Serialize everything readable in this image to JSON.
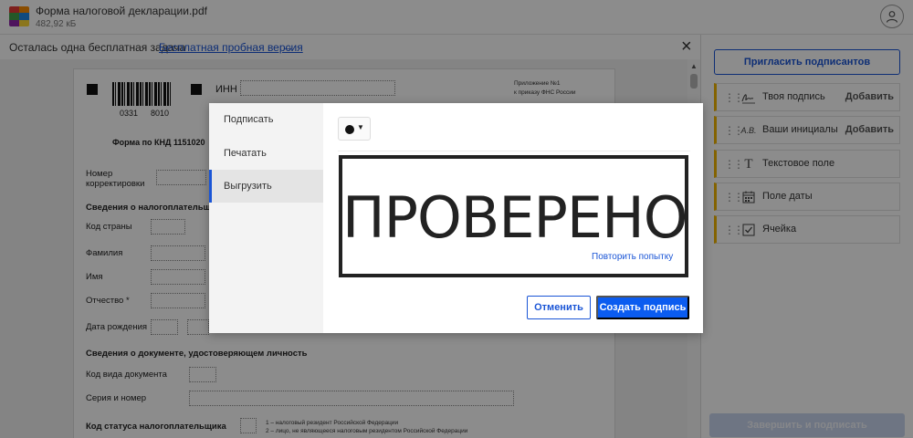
{
  "file": {
    "name": "Форма налоговой декларации.pdf",
    "size": "482,92 кБ"
  },
  "promo": {
    "text": "Осталась одна бесплатная задача",
    "link": "Бесплатная пробная версия"
  },
  "document": {
    "barcode_left": "0331",
    "barcode_right": "8010",
    "inn_label": "ИНН",
    "appendix_line1": "Приложение №1",
    "appendix_line2": "к приказу ФНС России",
    "form_title": "Форма по КНД 1151020",
    "correction_label_1": "Номер",
    "correction_label_2": "корректировки",
    "taxpayer_section": "Сведения о налогоплательщи",
    "country_code": "Код страны",
    "surname": "Фамилия",
    "name": "Имя",
    "patronymic": "Отчество *",
    "birth_date": "Дата рождения",
    "id_section": "Сведения о документе, удостоверяющем личность",
    "doc_type_code": "Код вида документа",
    "series_number": "Серия и номер",
    "status_code": "Код статуса налогоплательщика",
    "status_note_1": "1 – налоговый резидент Российской Федерации",
    "status_note_2": "2 – лицо, не являющееся налоговым резидентом Российской Федерации"
  },
  "sidebar": {
    "invite_button": "Пригласить подписантов",
    "fields": [
      {
        "label": "Твоя подпись",
        "action": "Добавить",
        "icon": "signature-icon"
      },
      {
        "label": "Ваши инициалы",
        "action": "Добавить",
        "icon": "initials-icon"
      },
      {
        "label": "Текстовое поле",
        "action": "",
        "icon": "text-icon"
      },
      {
        "label": "Поле даты",
        "action": "",
        "icon": "calendar-icon"
      },
      {
        "label": "Ячейка",
        "action": "",
        "icon": "checkbox-icon"
      }
    ],
    "initials_glyph": "A.B.",
    "text_glyph": "T",
    "finish_button": "Завершить и подписать"
  },
  "modal": {
    "nav": [
      "Подписать",
      "Печатать",
      "Выгрузить"
    ],
    "active_nav": "Выгрузить",
    "ink_color": "#111111",
    "stamp_text": "ПРОВЕРЕНО",
    "retry_link": "Повторить попытку",
    "cancel_button": "Отменить",
    "create_button": "Создать подпись"
  },
  "colors": {
    "accent": "#1a55d6",
    "primary_button": "#0b5cf0",
    "field_marker": "#f0b400"
  }
}
